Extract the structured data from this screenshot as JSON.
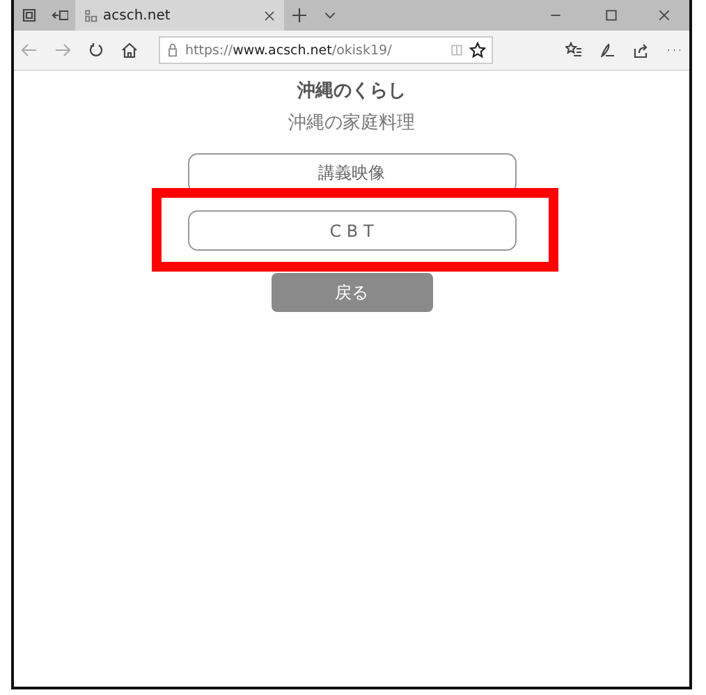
{
  "browser": {
    "tab_title": "acsch.net",
    "url": "https://**www.acsch.net**/okisk19/"
  },
  "page": {
    "title": "沖縄のくらし",
    "subtitle": "沖縄の家庭料理",
    "options": [
      {
        "label": "講義映像",
        "highlighted": false
      },
      {
        "label": "C B T",
        "highlighted": true
      }
    ],
    "back_button": "戻る"
  }
}
